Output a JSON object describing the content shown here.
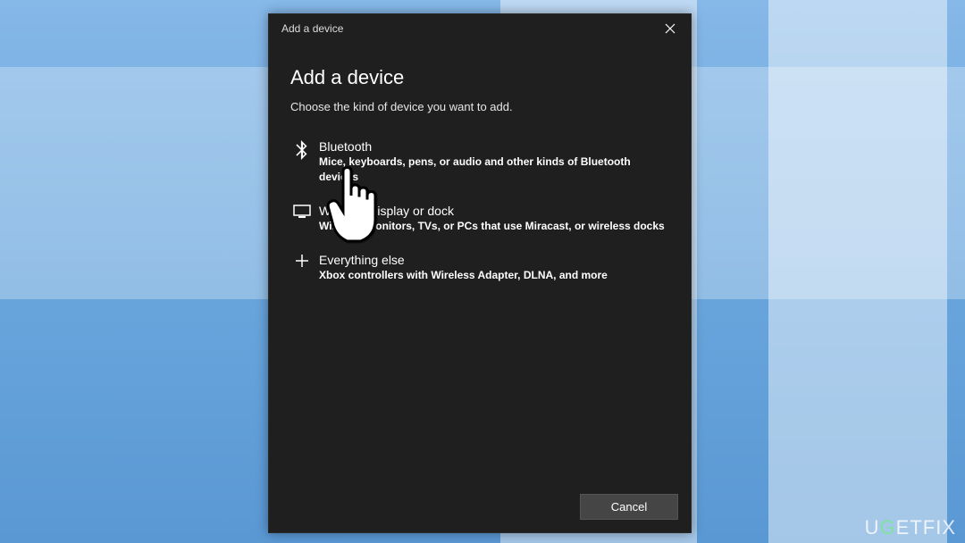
{
  "titlebar": {
    "title": "Add a device"
  },
  "dialog": {
    "heading": "Add a device",
    "subheading": "Choose the kind of device you want to add."
  },
  "options": {
    "bluetooth": {
      "title": "Bluetooth",
      "desc": "Mice, keyboards, pens, or audio and other kinds of Bluetooth devices"
    },
    "wireless": {
      "title": "Wireless display or dock",
      "desc": "Wireless monitors, TVs, or PCs that use Miracast, or wireless docks"
    },
    "everything": {
      "title": "Everything else",
      "desc": "Xbox controllers with Wireless Adapter, DLNA, and more"
    }
  },
  "footer": {
    "cancel": "Cancel"
  },
  "watermark": "UGETFIX"
}
